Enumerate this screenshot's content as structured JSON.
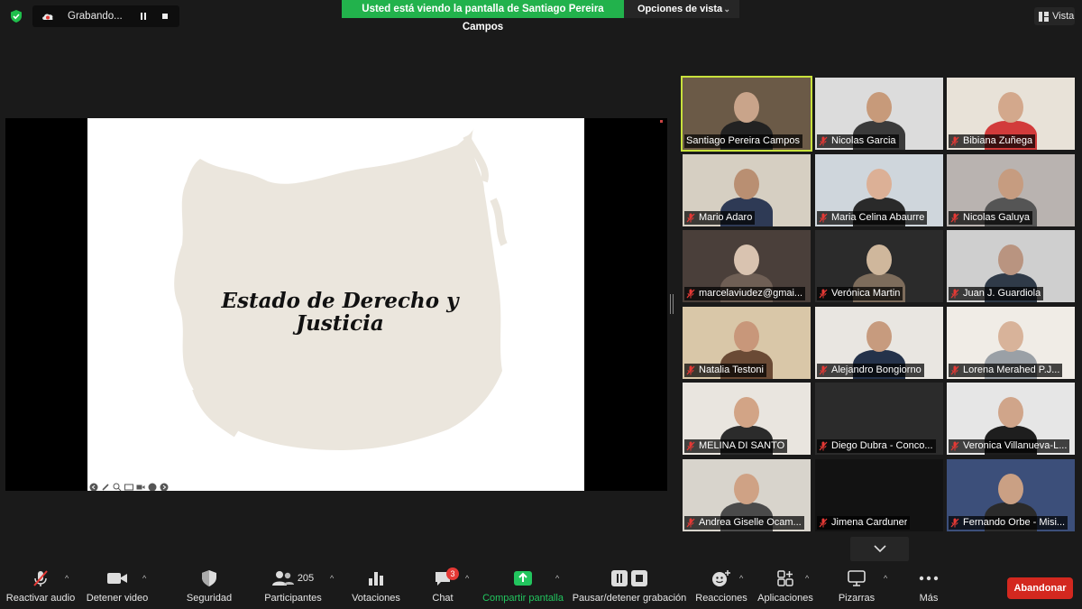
{
  "top_bar": {
    "recording_label": "Grabando...",
    "view_banner": "Usted está viendo la pantalla de Santiago Pereira Campos",
    "view_options_label": "Opciones de vista",
    "vista_label": "Vista"
  },
  "slide": {
    "title_line1": "Estado de Derecho y",
    "title_line2": "Justicia"
  },
  "participants": [
    {
      "name": "Santiago Pereira Campos",
      "muted": false,
      "active": true,
      "bg": "#6b5a47",
      "skin": "#c9a48a",
      "shirt": "#222"
    },
    {
      "name": "Nicolas Garcia",
      "muted": true,
      "active": false,
      "bg": "#dcdcdc",
      "skin": "#c79a7a",
      "shirt": "#3a3a3a"
    },
    {
      "name": "Bibiana Zuñega",
      "muted": true,
      "active": false,
      "bg": "#e8e2d8",
      "skin": "#d3a88c",
      "shirt": "#d23b3b"
    },
    {
      "name": "Mario Adaro",
      "muted": true,
      "active": false,
      "bg": "#d6cfc2",
      "skin": "#b98f72",
      "shirt": "#2e3a55"
    },
    {
      "name": "Maria Celina Abaurre",
      "muted": true,
      "active": false,
      "bg": "#cfd6dc",
      "skin": "#dcb096",
      "shirt": "#2a2a2a"
    },
    {
      "name": "Nicolas Galuya",
      "muted": true,
      "active": false,
      "bg": "#b9b3b0",
      "skin": "#c69c80",
      "shirt": "#555"
    },
    {
      "name": "marcelaviudez@gmai...",
      "muted": true,
      "active": false,
      "bg": "#4a3f3a",
      "skin": "#d9c3b0",
      "shirt": "#6f5f55"
    },
    {
      "name": "Verónica Martin",
      "muted": true,
      "active": false,
      "bg": "#2b2b2b",
      "skin": "#cfb79c",
      "shirt": "#7d6c5b"
    },
    {
      "name": "Juan J. Guardiola",
      "muted": true,
      "active": false,
      "bg": "#cfcfcf",
      "skin": "#b99480",
      "shirt": "#2f3a48"
    },
    {
      "name": "Natalia Testoni",
      "muted": true,
      "active": false,
      "bg": "#d9c7a8",
      "skin": "#c8977a",
      "shirt": "#6a4a35"
    },
    {
      "name": "Alejandro Bongiorno",
      "muted": true,
      "active": false,
      "bg": "#e9e6e1",
      "skin": "#c79b7e",
      "shirt": "#24324a"
    },
    {
      "name": "Lorena Merahed P.J...",
      "muted": true,
      "active": false,
      "bg": "#f0ece6",
      "skin": "#d8b39a",
      "shirt": "#9aa0a6"
    },
    {
      "name": "MELINA DI SANTO",
      "muted": true,
      "active": false,
      "bg": "#e9e5df",
      "skin": "#d2a486",
      "shirt": "#2b2b2b"
    },
    {
      "name": "Diego Dubra - Conco...",
      "muted": true,
      "active": false,
      "bg": "#2b2b2b",
      "skin": "",
      "shirt": ""
    },
    {
      "name": "Veronica Villanueva-L...",
      "muted": true,
      "active": false,
      "bg": "#e6e6e6",
      "skin": "#d0a58a",
      "shirt": "#1e1e1e"
    },
    {
      "name": "Andrea Giselle Ocam...",
      "muted": true,
      "active": false,
      "bg": "#d8d4cc",
      "skin": "#cfa285",
      "shirt": "#4a4a4a"
    },
    {
      "name": "Jimena Carduner",
      "muted": true,
      "active": false,
      "bg": "#121212",
      "skin": "",
      "shirt": ""
    },
    {
      "name": "Fernando Orbe - Misi...",
      "muted": true,
      "active": false,
      "bg": "#3c4f7a",
      "skin": "#caa084",
      "shirt": "#2a2a2a"
    }
  ],
  "toolbar": {
    "mute_label": "Reactivar audio",
    "video_label": "Detener video",
    "security_label": "Seguridad",
    "participants_label": "Participantes",
    "participants_count": "205",
    "polls_label": "Votaciones",
    "chat_label": "Chat",
    "chat_badge": "3",
    "share_label": "Compartir pantalla",
    "record_label": "Pausar/detener grabación",
    "reactions_label": "Reacciones",
    "apps_label": "Aplicaciones",
    "whiteboards_label": "Pizarras",
    "more_label": "Más",
    "leave_label": "Abandonar"
  },
  "colors": {
    "accent_green": "#22b24c",
    "leave_red": "#d3281f",
    "active_speaker": "#c8e13c",
    "muted_red": "#e53935"
  }
}
